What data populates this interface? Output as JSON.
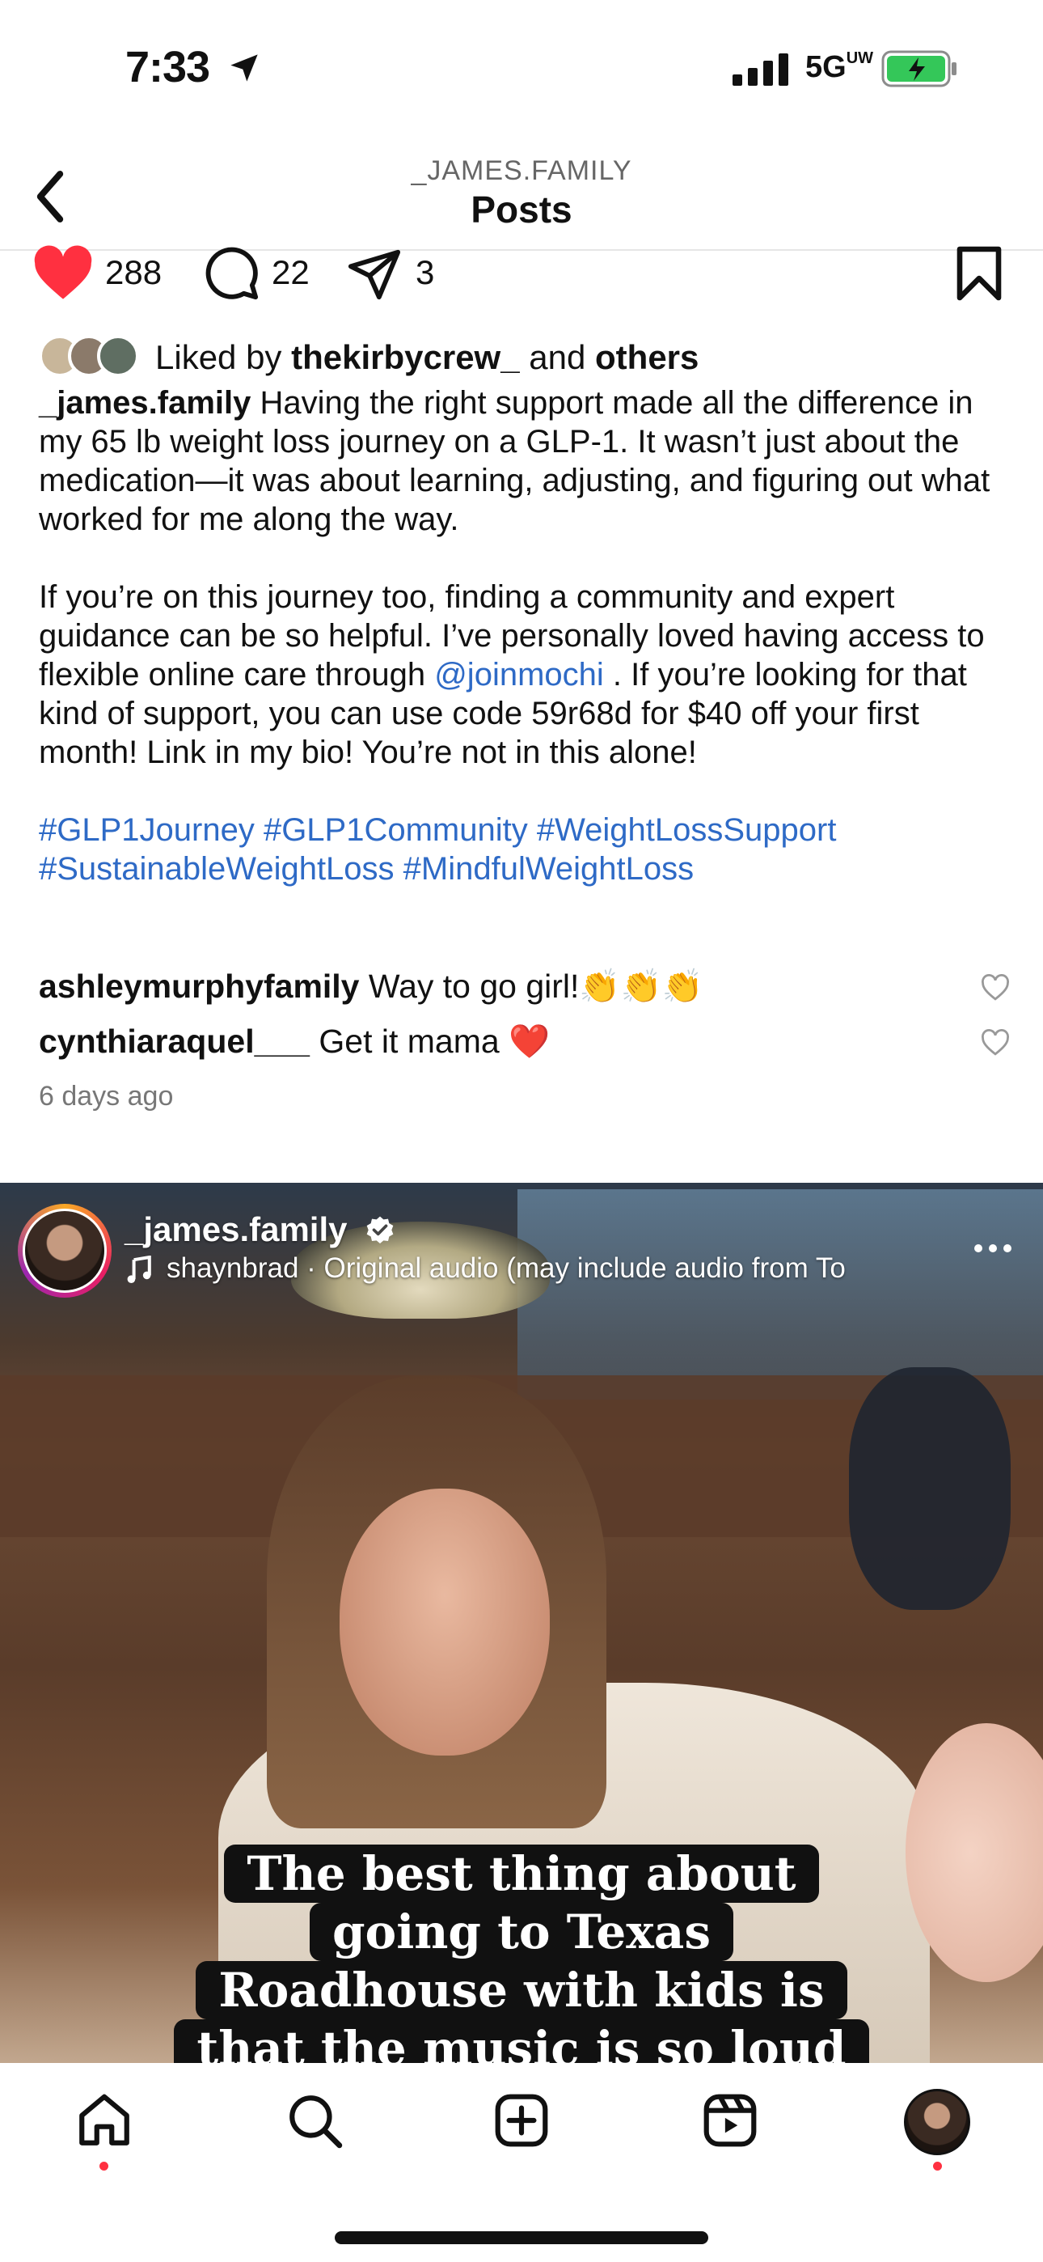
{
  "status_bar": {
    "time": "7:33",
    "network": "5G",
    "network_sub": "UW",
    "location_icon": "location-arrow-icon",
    "signal_icon": "cellular-signal-icon",
    "battery_icon": "battery-charging-icon"
  },
  "header": {
    "username": "_JAMES.FAMILY",
    "title": "Posts",
    "back_icon": "chevron-left-icon"
  },
  "post": {
    "likes": "288",
    "comments": "22",
    "shares": "3",
    "liked_by_prefix": "Liked by ",
    "liked_by_user": "thekirbycrew_",
    "liked_by_and": " and ",
    "liked_by_others": "others",
    "caption_user": "_james.family",
    "caption_p1": " Having the right support made all the difference in my 65 lb weight loss journey on a GLP-1. It wasn’t just about the medication—it was about learning, adjusting, and figuring out what worked for me along the way.",
    "caption_p2_before": "If you’re on this journey too, finding a community and expert guidance can be so helpful. I’ve personally loved having access to flexible online care through ",
    "caption_mention": "@joinmochi",
    "caption_p2_after": " . If you’re looking for that kind of support, you can use code 59r68d for $40 off your first month! Link in my bio! You’re not in this alone!",
    "hashtags": "#GLP1Journey #GLP1Community #WeightLossSupport #SustainableWeightLoss #MindfulWeightLoss",
    "comments_list": [
      {
        "user": "ashleymurphyfamily",
        "text": " Way to go girl!👏👏👏"
      },
      {
        "user": "cynthiaraquel___",
        "text": " Get it mama ❤️"
      }
    ],
    "time_ago": "6 days ago",
    "accent_like": "#ff3040",
    "link_color": "#2e6ac6"
  },
  "next_post": {
    "username": "_james.family",
    "audio": "shaynbrad · Original audio  (may include audio from To",
    "overlay_lines": [
      "The best thing about",
      "going to Texas",
      "Roadhouse with kids is",
      "that the music is so loud"
    ]
  },
  "nav": {
    "items": [
      "home-icon",
      "search-icon",
      "create-icon",
      "reels-icon",
      "profile-avatar"
    ]
  }
}
